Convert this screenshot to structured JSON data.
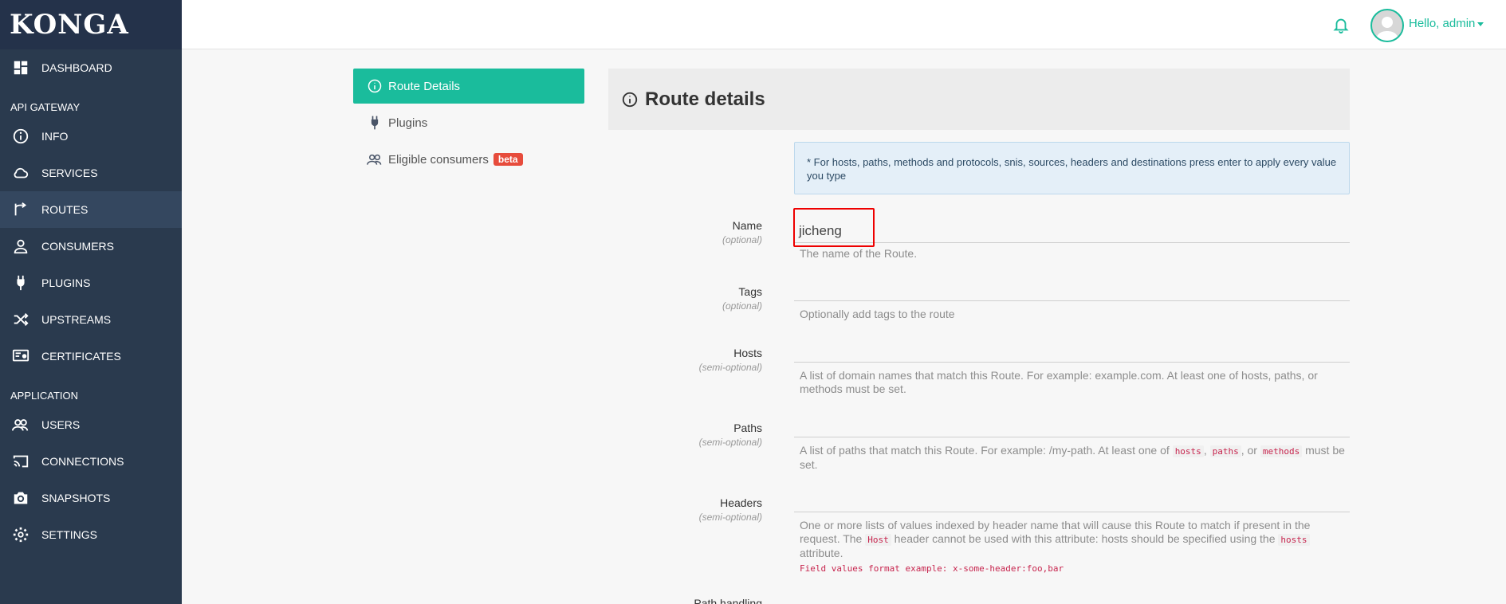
{
  "app": {
    "logo": "KONGA"
  },
  "sidebar": {
    "items": [
      {
        "key": "dashboard",
        "label": "DASHBOARD"
      },
      {
        "key": "section-api",
        "label": "API GATEWAY"
      },
      {
        "key": "info",
        "label": "INFO"
      },
      {
        "key": "services",
        "label": "SERVICES"
      },
      {
        "key": "routes",
        "label": "ROUTES"
      },
      {
        "key": "consumers",
        "label": "CONSUMERS"
      },
      {
        "key": "plugins",
        "label": "PLUGINS"
      },
      {
        "key": "upstreams",
        "label": "UPSTREAMS"
      },
      {
        "key": "certificates",
        "label": "CERTIFICATES"
      },
      {
        "key": "section-app",
        "label": "APPLICATION"
      },
      {
        "key": "users",
        "label": "USERS"
      },
      {
        "key": "connections",
        "label": "CONNECTIONS"
      },
      {
        "key": "snapshots",
        "label": "SNAPSHOTS"
      },
      {
        "key": "settings",
        "label": "SETTINGS"
      }
    ],
    "active": "ROUTES"
  },
  "topbar": {
    "greeting": "Hello, admin"
  },
  "subnav": {
    "route_details": "Route Details",
    "plugins": "Plugins",
    "eligible_consumers": "Eligible consumers",
    "beta_badge": "beta"
  },
  "panel": {
    "title": "Route details",
    "info_note": "* For hosts, paths, methods and protocols, snis, sources, headers and destinations press enter to apply every value you type"
  },
  "form": {
    "name": {
      "label": "Name",
      "sub": "(optional)",
      "value": "jicheng",
      "help": "The name of the Route."
    },
    "tags": {
      "label": "Tags",
      "sub": "(optional)",
      "help": "Optionally add tags to the route"
    },
    "hosts": {
      "label": "Hosts",
      "sub": "(semi-optional)",
      "help": "A list of domain names that match this Route. For example: example.com. At least one of hosts, paths, or methods must be set."
    },
    "paths": {
      "label": "Paths",
      "sub": "(semi-optional)",
      "help_pre": "A list of paths that match this Route. For example: /my-path. At least one of",
      "code1": "hosts",
      "sep1": ",",
      "code2": "paths",
      "sep2": ", or",
      "code3": "methods",
      "help_post": "must be set."
    },
    "headers": {
      "label": "Headers",
      "sub": "(semi-optional)",
      "help_pre": "One or more lists of values indexed by header name that will cause this Route to match if present in the request. The",
      "code1": "Host",
      "help_mid": "header cannot be used with this attribute: hosts should be specified using the",
      "code2": "hosts",
      "help_post": "attribute.",
      "example": "Field values format example: x-some-header:foo,bar"
    },
    "path_handling": {
      "label": "Path handling"
    }
  }
}
